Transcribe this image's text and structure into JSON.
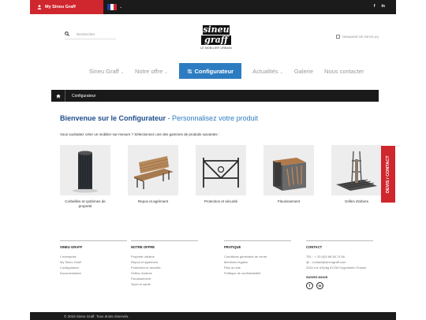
{
  "topbar": {
    "account_label": "My Sineu Graff",
    "language_caret": "⌄",
    "social": [
      "f",
      "in"
    ]
  },
  "header": {
    "search_placeholder": "Rechercher",
    "logo_line1": "sineu",
    "logo_line2": "graff",
    "logo_tagline": "LE MOBILIER URBAIN",
    "quote_label": "DEMANDE DE DEVIS (0)"
  },
  "nav": {
    "items": [
      {
        "label": "Sineu Graff",
        "caret": "⌄"
      },
      {
        "label": "Notre offre",
        "caret": "⌄"
      },
      {
        "label": "Configurateur",
        "active": true
      },
      {
        "label": "Actualités",
        "caret": "⌄"
      },
      {
        "label": "Galerie"
      },
      {
        "label": "Nous contacter"
      }
    ]
  },
  "breadcrumb": {
    "current": "Configurateur"
  },
  "main": {
    "heading_main": "Bienvenue sur le Configurateur",
    "heading_sep": " - ",
    "heading_sub": "Personnalisez votre produit",
    "intro": "Vous souhaitez créer un mobilier sur-mesure ? Sélectionnez une des gammes de produits suivantes :",
    "products": [
      {
        "label": "Corbeilles et systèmes de propreté"
      },
      {
        "label": "Repos et agrément"
      },
      {
        "label": "Protection et sécurité"
      },
      {
        "label": "Fleurissement"
      },
      {
        "label": "Grilles d'arbres"
      }
    ]
  },
  "side_tab": "DEVIS / CONTACT",
  "footer": {
    "col1": {
      "title": "SINEU GRAFF",
      "links": [
        "L'entreprise",
        "My Sineu Graff",
        "Configurateur",
        "Documentation"
      ]
    },
    "col2": {
      "title": "NOTRE OFFRE",
      "links": [
        "Propreté urbaine",
        "Repos et agrément",
        "Protection et sécurité",
        "Grilles d'arbres",
        "Fleurissement",
        "Sport et santé"
      ]
    },
    "col3": {
      "title": "PRATIQUE",
      "links": [
        "Conditions générales de vente",
        "Mentions légales",
        "Plan du site",
        "Politique de confidentialité"
      ]
    },
    "col4": {
      "title": "CONTACT",
      "lines": [
        "TEL : + 33 (0)3 88 58 74 58",
        "@ : contact@sineugraff.com",
        "3334 rue d'Epfig 67230 Kogenheim France"
      ],
      "follow": "SUIVEZ-NOUS",
      "social": [
        "f",
        "in"
      ]
    }
  },
  "bottom": {
    "copyright": "© 2019 Sineu Graff. Tous droits réservés."
  },
  "colors": {
    "accent": "#2d7cc1",
    "brand_red": "#d0262d",
    "heading_blue": "#1f4e8c",
    "dark": "#1b1b1b"
  }
}
